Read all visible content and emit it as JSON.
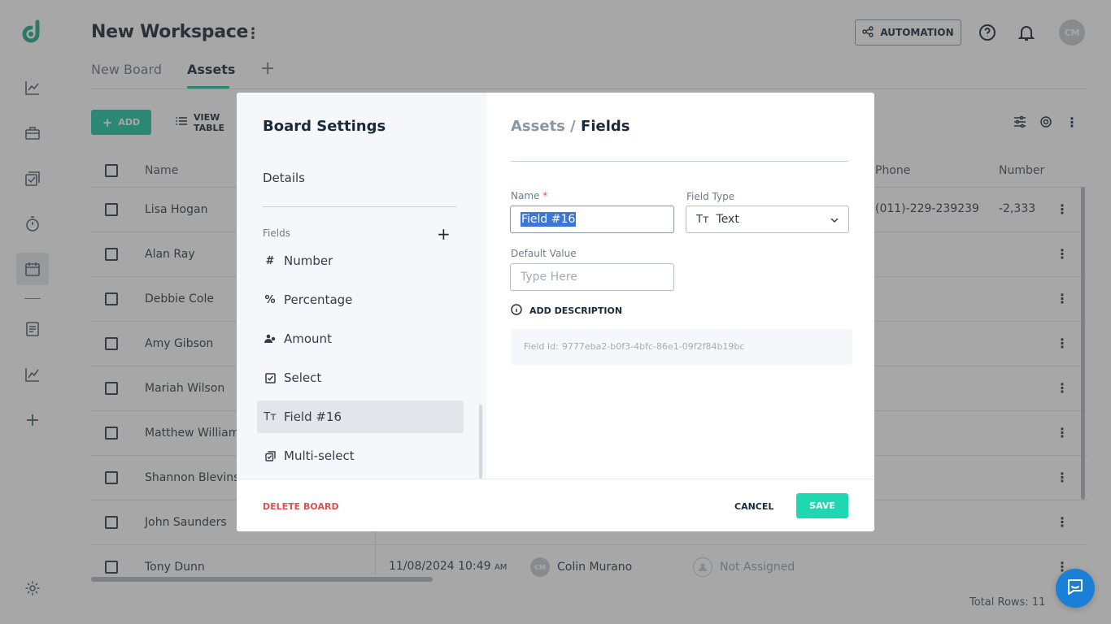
{
  "workspace": {
    "title": "New Workspace"
  },
  "tabs": [
    {
      "label": "New Board"
    },
    {
      "label": "Assets"
    }
  ],
  "header": {
    "automation_label": "AUTOMATION",
    "avatar_initials": "CM"
  },
  "toolbar": {
    "add_label": "ADD",
    "view_label": "VIEW TABLE"
  },
  "grid": {
    "columns": [
      "Name",
      "Phone",
      "Number"
    ],
    "rows": [
      {
        "name": "Lisa Hogan"
      },
      {
        "name": "Alan Ray"
      },
      {
        "name": "Debbie Cole"
      },
      {
        "name": "Amy Gibson"
      },
      {
        "name": "Mariah Wilson"
      },
      {
        "name": "Matthew Williams"
      },
      {
        "name": "Shannon Blevins"
      },
      {
        "name": "John Saunders"
      },
      {
        "name": "Tony Dunn"
      }
    ],
    "first_row_phone": "(011)-229-239239",
    "first_row_number": "-2,333",
    "last_row": {
      "date": "11/08/2024 10:49",
      "date_suffix": "AM",
      "owner_initials": "CM",
      "owner": "Colin Murano",
      "assignee": "Not Assigned"
    },
    "total_rows": "Total Rows: 11"
  },
  "modal": {
    "title": "Board Settings",
    "details_label": "Details",
    "fields_label": "Fields",
    "fields": [
      {
        "icon": "hash-icon",
        "label": "Number"
      },
      {
        "icon": "percent-icon",
        "label": "Percentage"
      },
      {
        "icon": "amount-icon",
        "label": "Amount"
      },
      {
        "icon": "checkbox-icon",
        "label": "Select"
      },
      {
        "icon": "text-type-icon",
        "label": "Field #16"
      },
      {
        "icon": "multi-select-icon",
        "label": "Multi-select"
      }
    ],
    "breadcrumb_parent": "Assets",
    "breadcrumb_sep": "/",
    "breadcrumb_current": "Fields",
    "name_label": "Name",
    "name_required": "*",
    "name_value": "Field #16",
    "field_type_label": "Field Type",
    "field_type_value": "Text",
    "default_value_label": "Default Value",
    "default_value_placeholder": "Type Here",
    "add_description_label": "ADD DESCRIPTION",
    "field_id_label": "Field Id:",
    "field_id_value": "9777eba2-b0f3-4bfc-86e1-09f2f84b19bc",
    "delete_label": "DELETE BOARD",
    "cancel_label": "CANCEL",
    "save_label": "SAVE"
  },
  "colors": {
    "accent": "#1fc7a3",
    "danger": "#e04e4e",
    "chat": "#1a7fd6"
  }
}
